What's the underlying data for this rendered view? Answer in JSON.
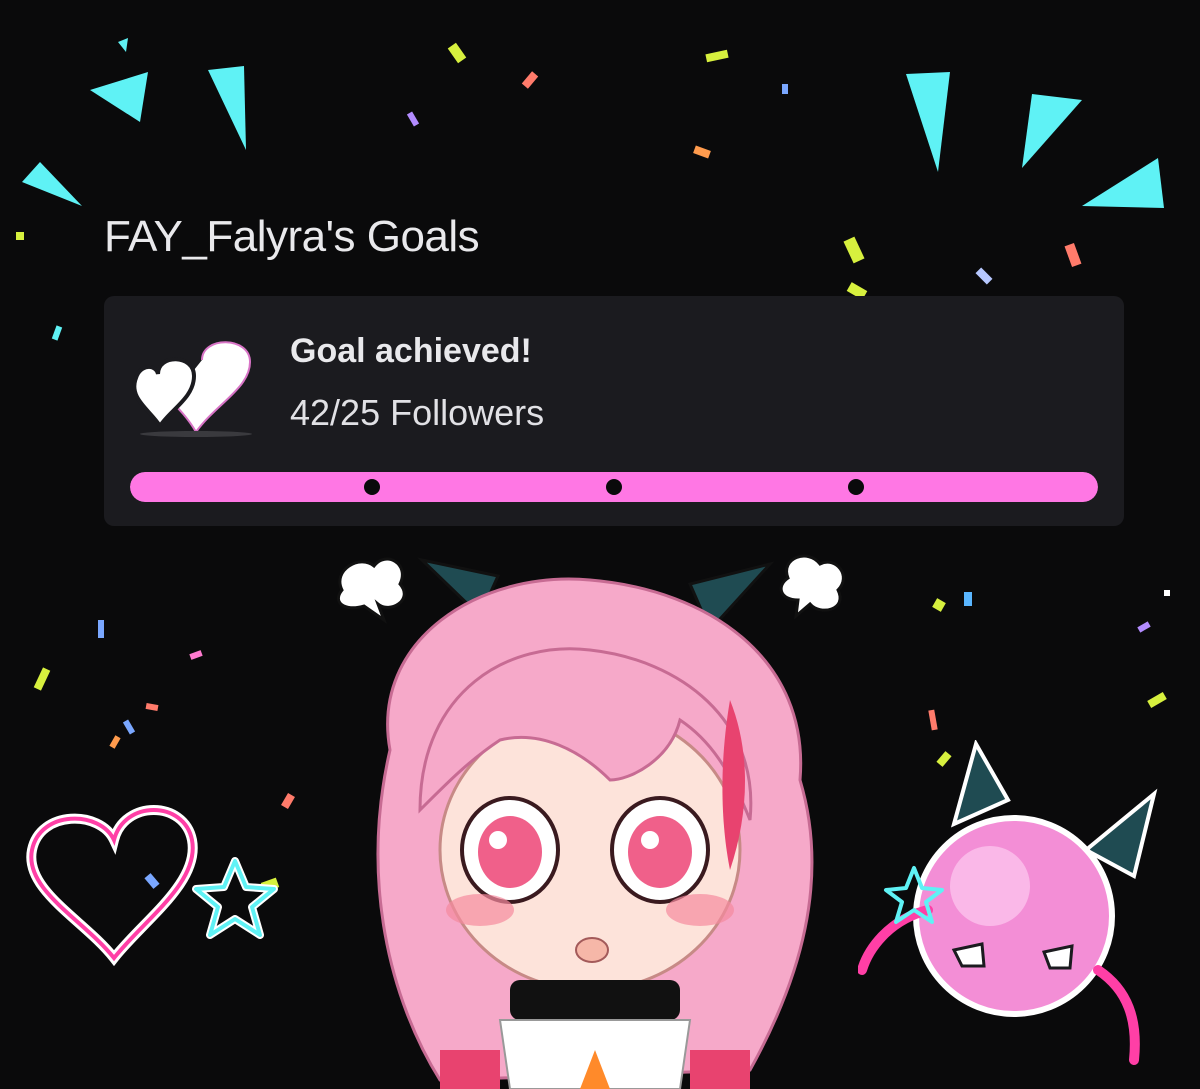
{
  "page": {
    "title": "FAY_Falyra's Goals"
  },
  "goal": {
    "status": "Goal achieved!",
    "progress_text": "42/25 Followers",
    "current": 42,
    "target": 25,
    "fraction": 1.0,
    "milestone_fractions": [
      0.25,
      0.5,
      0.75
    ],
    "icon": "double-heart-icon"
  },
  "colors": {
    "background": "#0a0a0b",
    "card": "#1b1b1f",
    "bar_fill": "#ff77e4",
    "burst": "#5ff2f5",
    "mascot_hair": "#f6a9c9",
    "creature": "#f38ed6"
  },
  "decorations": {
    "burst_lines": "burst-lines-icon",
    "confetti": "confetti-icon",
    "heart": "outline-heart-icon",
    "star": "cyan-star-icon",
    "mascot": "chibi-character-illustration",
    "creature": "pink-blob-creature-illustration"
  }
}
